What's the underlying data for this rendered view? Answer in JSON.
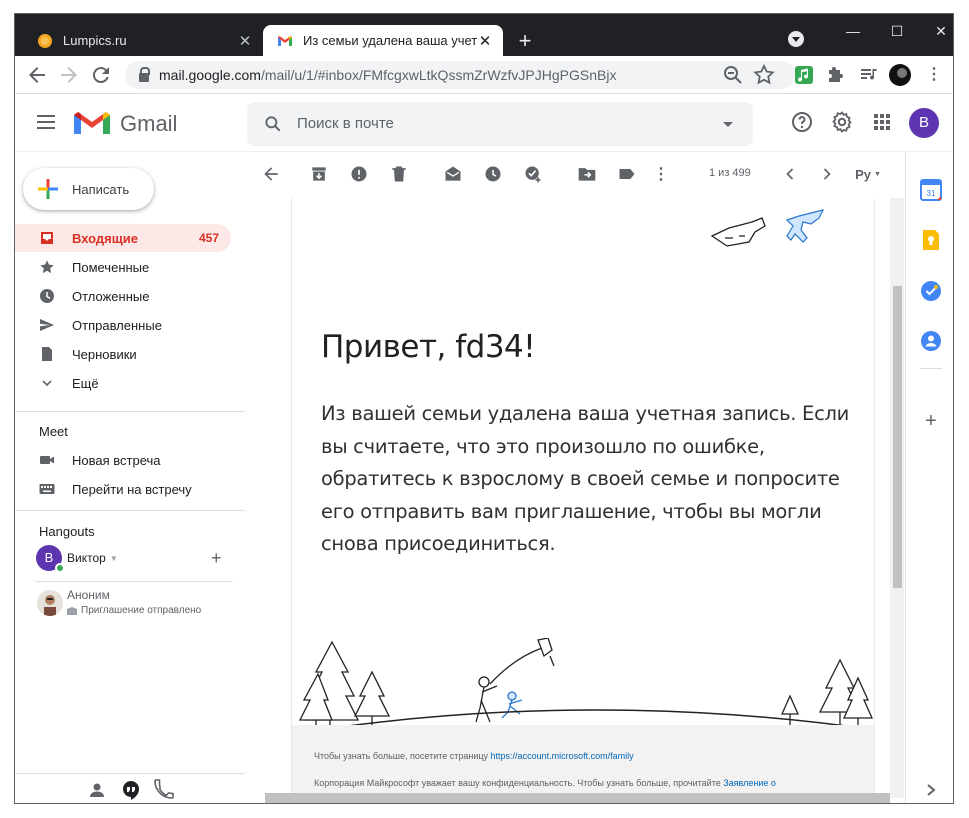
{
  "browser": {
    "tabs": [
      {
        "title": "Lumpics.ru",
        "favicon": "lumpics-orange-circle"
      },
      {
        "title": "Из семьи удалена ваша учетная",
        "favicon": "gmail-icon"
      }
    ],
    "new_tab": "+",
    "close": "✕",
    "window_controls": {
      "minimize": "—",
      "maximize": "☐",
      "close": "✕"
    },
    "url": {
      "host": "mail.google.com",
      "path": "/mail/u/1/#inbox/FMfcgxwLtkQssmZrWzfvJPJHgPGSnBjx"
    }
  },
  "gmail": {
    "logo_text": "Gmail",
    "search_placeholder": "Поиск в почте",
    "avatar_letter": "B",
    "compose_label": "Написать",
    "nav": [
      {
        "label": "Входящие",
        "count": "457",
        "icon": "inbox-icon",
        "active": true
      },
      {
        "label": "Помеченные",
        "count": "",
        "icon": "star-icon",
        "active": false
      },
      {
        "label": "Отложенные",
        "count": "",
        "icon": "clock-icon",
        "active": false
      },
      {
        "label": "Отправленные",
        "count": "",
        "icon": "send-icon",
        "active": false
      },
      {
        "label": "Черновики",
        "count": "",
        "icon": "draft-icon",
        "active": false
      },
      {
        "label": "Ещё",
        "count": "",
        "icon": "chevron-down-icon",
        "active": false
      }
    ],
    "meet": {
      "heading": "Meet",
      "items": [
        {
          "label": "Новая встреча",
          "icon": "video-icon"
        },
        {
          "label": "Перейти на встречу",
          "icon": "keyboard-icon"
        }
      ]
    },
    "hangouts": {
      "heading": "Hangouts",
      "user_name": "Виктор",
      "user_initial": "B",
      "add": "+",
      "contact_name": "Аноним",
      "contact_status": "Приглашение отправлено"
    },
    "pager": "1 из 499",
    "lang_button": "Ру"
  },
  "email": {
    "greeting": "Привет, fd34!",
    "body": "Из вашей семьи удалена ваша учетная запись. Если вы считаете, что это произошло по ошибке, обратитесь к взрослому в своей семье и попросите его отправить вам приглашение, чтобы вы могли снова присоединиться.",
    "footer_line1_text": "Чтобы узнать больше, посетите страницу ",
    "footer_line1_link": "https://account.microsoft.com/family",
    "footer_line2_text": "Корпорация Майкрософт уважает вашу конфиденциальность. Чтобы узнать больше, прочитайте ",
    "footer_line2_link": "Заявление о"
  },
  "colors": {
    "gmail_red": "#d93025",
    "active_nav_bg": "#fce8e6",
    "avatar_purple": "#5e35b1",
    "link_blue": "#0067b8"
  }
}
